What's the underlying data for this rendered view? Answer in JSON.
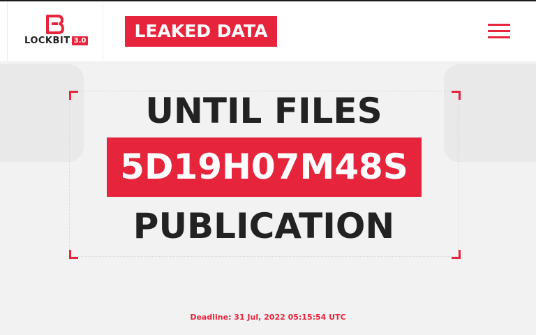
{
  "header": {
    "brand": {
      "name": "LOCKBIT",
      "version": "3.0"
    },
    "section_label": "LEAKED DATA",
    "menu_icon": "hamburger-menu-icon"
  },
  "countdown": {
    "line_top": "UNTIL FILES",
    "timer": "5D19H07M48S",
    "line_bottom": "PUBLICATION",
    "deadline": "Deadline: 31 Jul, 2022 05:15:54 UTC"
  },
  "colors": {
    "accent": "#e6253c",
    "text_dark": "#222222",
    "background": "#f2f2f2",
    "header_background": "#ffffff"
  }
}
